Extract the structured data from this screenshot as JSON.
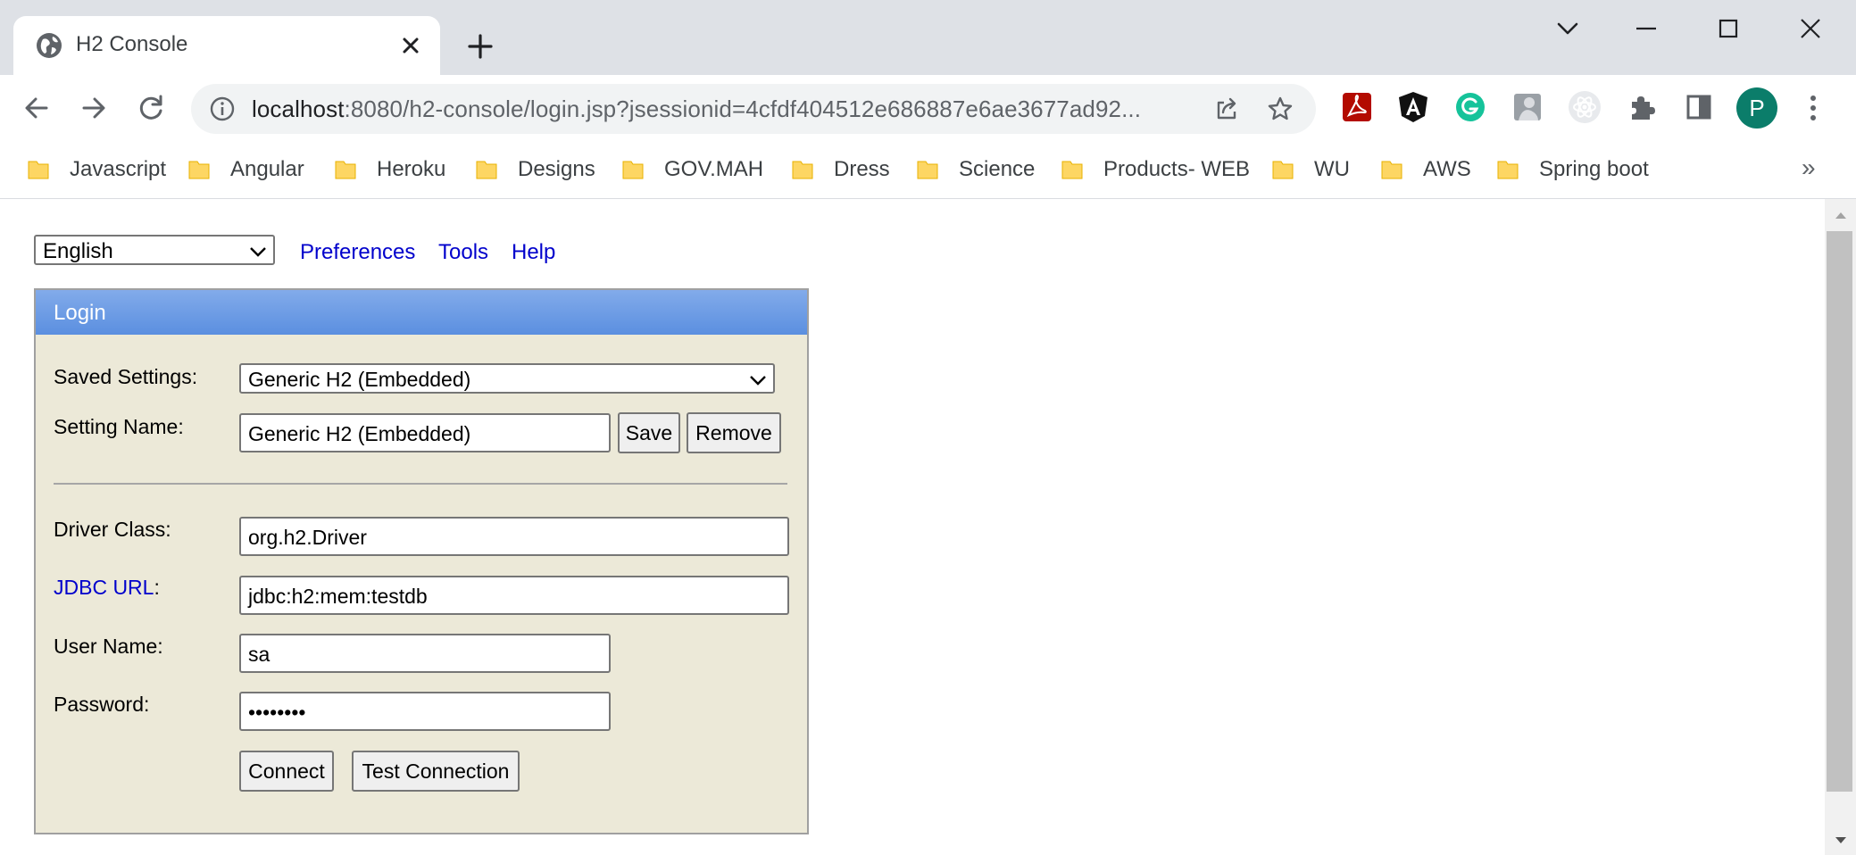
{
  "browser": {
    "tab": {
      "title": "H2 Console"
    },
    "address": {
      "host": "localhost",
      "rest": ":8080/h2-console/login.jsp?jsessionid=4cfdf404512e686887e6ae3677ad92..."
    },
    "profile_initial": "P",
    "bookmarks": [
      {
        "label": "Javascript"
      },
      {
        "label": "Angular"
      },
      {
        "label": "Heroku"
      },
      {
        "label": "Designs"
      },
      {
        "label": "GOV.MAH"
      },
      {
        "label": "Dress"
      },
      {
        "label": "Science"
      },
      {
        "label": "Products- WEB"
      },
      {
        "label": "WU"
      },
      {
        "label": "AWS"
      },
      {
        "label": "Spring boot"
      }
    ],
    "bookmarks_overflow": "»"
  },
  "page": {
    "language": "English",
    "nav": {
      "preferences": "Preferences",
      "tools": "Tools",
      "help": "Help"
    },
    "login": {
      "header": "Login",
      "saved_settings_label": "Saved Settings:",
      "saved_settings_value": "Generic H2 (Embedded)",
      "setting_name_label": "Setting Name:",
      "setting_name_value": "Generic H2 (Embedded)",
      "save_button": "Save",
      "remove_button": "Remove",
      "driver_class_label": "Driver Class:",
      "driver_class_value": "org.h2.Driver",
      "jdbc_url_label": "JDBC URL",
      "jdbc_url_colon": ":",
      "jdbc_url_value": "jdbc:h2:mem:testdb",
      "user_name_label": "User Name:",
      "user_name_value": "sa",
      "password_label": "Password:",
      "password_value": "••••••••",
      "connect_button": "Connect",
      "test_connection_button": "Test Connection"
    }
  },
  "colors": {
    "tabstrip": "#dee1e6",
    "login_panel": "#ece9d8",
    "login_header": "#6f9de6",
    "link": "#0000cc",
    "avatar": "#0b7d6a"
  }
}
